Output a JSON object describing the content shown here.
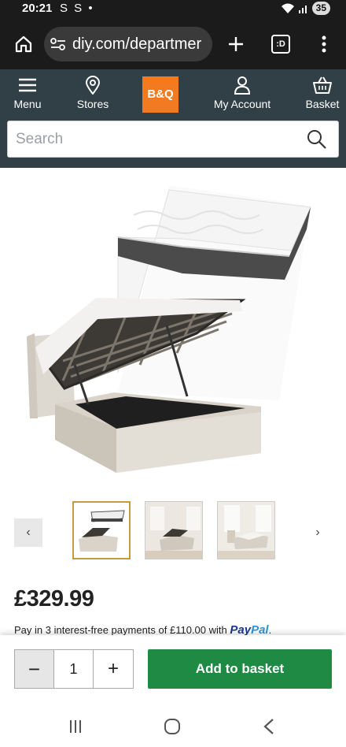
{
  "status_bar": {
    "time": "20:21",
    "notifications": "S S •",
    "battery": "35"
  },
  "browser": {
    "url": "diy.com/departmer",
    "tabs_icon_label": ":D"
  },
  "header": {
    "nav": [
      {
        "label": "Menu",
        "icon": "menu-icon"
      },
      {
        "label": "Stores",
        "icon": "location-pin-icon"
      },
      {
        "label": "My Account",
        "icon": "account-icon"
      },
      {
        "label": "Basket",
        "icon": "basket-icon"
      }
    ],
    "logo_text": "B&Q",
    "search": {
      "placeholder": "Search",
      "value": ""
    }
  },
  "product": {
    "price": "£329.99",
    "paypal": {
      "text_before": "Pay in 3 interest-free payments of £110.00 with ",
      "brand_part1": "Pay",
      "brand_part2": "Pal",
      "text_after": "."
    }
  },
  "gallery": {
    "prev_label": "‹",
    "next_label": "›",
    "active_index": 0,
    "thumbnail_count": 3
  },
  "purchase": {
    "qty_minus": "−",
    "quantity": "1",
    "qty_plus": "+",
    "add_label": "Add to basket"
  },
  "colors": {
    "header_bg": "#313f47",
    "logo_orange": "#f47a20",
    "add_button_green": "#1e8a43"
  }
}
